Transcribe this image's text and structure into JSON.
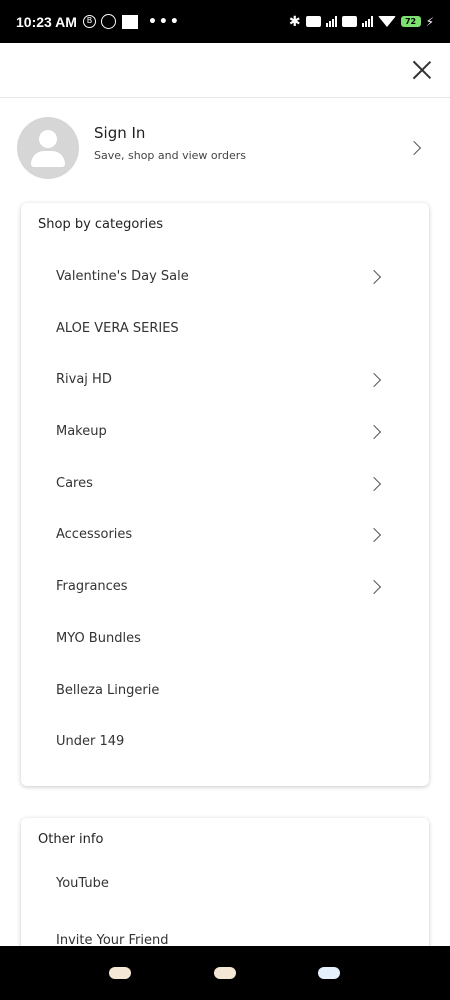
{
  "status_bar": {
    "time": "10:23 AM",
    "badge": "B",
    "battery": "72",
    "icons": [
      "whatsapp-icon",
      "news-icon",
      "more-dots-icon",
      "bluetooth-icon",
      "volte-icon",
      "signal-icon",
      "wifi-icon",
      "battery-icon",
      "charging-icon"
    ]
  },
  "signin": {
    "title": "Sign In",
    "subtitle": "Save, shop and view orders"
  },
  "categories": {
    "title": "Shop by categories",
    "items": [
      {
        "label": "Valentine's Day Sale",
        "has_children": true
      },
      {
        "label": "ALOE VERA SERIES",
        "has_children": false
      },
      {
        "label": "Rivaj HD",
        "has_children": true
      },
      {
        "label": "Makeup",
        "has_children": true
      },
      {
        "label": "Cares",
        "has_children": true
      },
      {
        "label": "Accessories",
        "has_children": true
      },
      {
        "label": "Fragrances",
        "has_children": true
      },
      {
        "label": "MYO Bundles",
        "has_children": false
      },
      {
        "label": "Belleza Lingerie",
        "has_children": false
      },
      {
        "label": "Under 149",
        "has_children": false
      }
    ]
  },
  "other_info": {
    "title": "Other info",
    "items": [
      {
        "label": "YouTube"
      },
      {
        "label": "Invite Your Friend"
      }
    ]
  },
  "colors": {
    "avatar_bg": "#d6d6d6",
    "text": "#222222",
    "nav_pill": "#f4e7d6",
    "battery": "#7ee070"
  }
}
